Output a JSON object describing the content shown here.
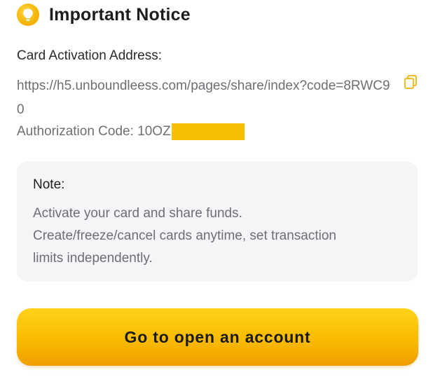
{
  "header": {
    "title": "Important Notice",
    "icon": "lightbulb-icon"
  },
  "activation": {
    "label": "Card Activation Address:",
    "url": "https://h5.unboundleess.com/pages/share/index?code=8RWC90",
    "copy_icon": "copy-icon"
  },
  "authorization": {
    "label": "Authorization Code: 10OZ"
  },
  "note": {
    "title": "Note:",
    "lines": [
      "Activate your card and share funds.",
      "Create/freeze/cancel cards anytime, set transaction",
      "limits independently."
    ]
  },
  "cta": {
    "label": "Go to open an account"
  },
  "colors": {
    "accent": "#F7B500",
    "redaction": "#F6C000",
    "note_background": "#F5F5F7",
    "muted_text": "#6E6E73"
  }
}
